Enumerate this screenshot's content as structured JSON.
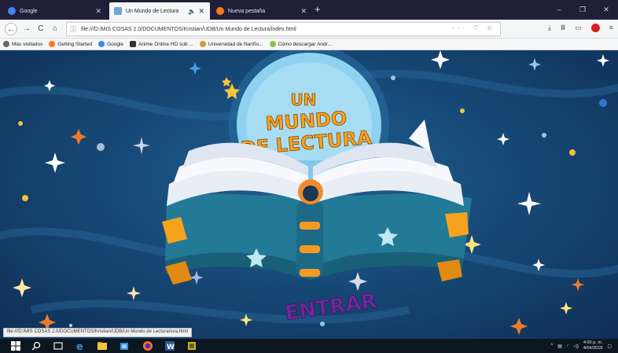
{
  "browser": {
    "tabs": [
      {
        "label": "Google",
        "favicon": "google-icon",
        "active": false
      },
      {
        "label": "Un Mundo de Lectura",
        "favicon": "page-icon",
        "active": true,
        "audio": true
      },
      {
        "label": "Nueva pestaña",
        "favicon": "firefox-icon",
        "active": false
      }
    ],
    "new_tab": "+",
    "window_controls": {
      "minimize": "–",
      "maximize": "❐",
      "close": "✕"
    },
    "nav": {
      "back": "←",
      "forward": "→",
      "reload": "C",
      "home": "⌂"
    },
    "url": "file:///D:/MIS COSAS 2.0/DOCUMENTOS/Kristian/UDB/Un Mundo de Lectura/index.html",
    "url_actions": "··· ♡ ☆",
    "bookmarks": [
      {
        "label": "Más visitados",
        "icon": "gear-icon"
      },
      {
        "label": "Getting Started",
        "icon": "firefox-icon"
      },
      {
        "label": "Google",
        "icon": "google-icon"
      },
      {
        "label": "Anime Online HD sub ...",
        "icon": "anime-icon"
      },
      {
        "label": "Universidad de Nariño...",
        "icon": "university-icon"
      },
      {
        "label": "Cómo descargar Andr...",
        "icon": "android-icon"
      }
    ]
  },
  "page": {
    "title_line1": "UN",
    "title_line2": "MUNDO",
    "title_line3": "DE LECTURA",
    "enter_button": "ENTRAR"
  },
  "status_bar": "file:///D:/MIS COSAS 2.0/DOCUMENTOS/Kristian/UDB/Un Mundo de Lectura/ova.html",
  "taskbar": {
    "time": "4:00 p. m.",
    "date": "4/04/2018"
  },
  "colors": {
    "background_dark": "#0f2f57",
    "book_teal": "#2a8aa6",
    "title_orange": "#f6a21c",
    "entrar_purple": "#6b2a9a",
    "moon": "#8fd2f0"
  }
}
